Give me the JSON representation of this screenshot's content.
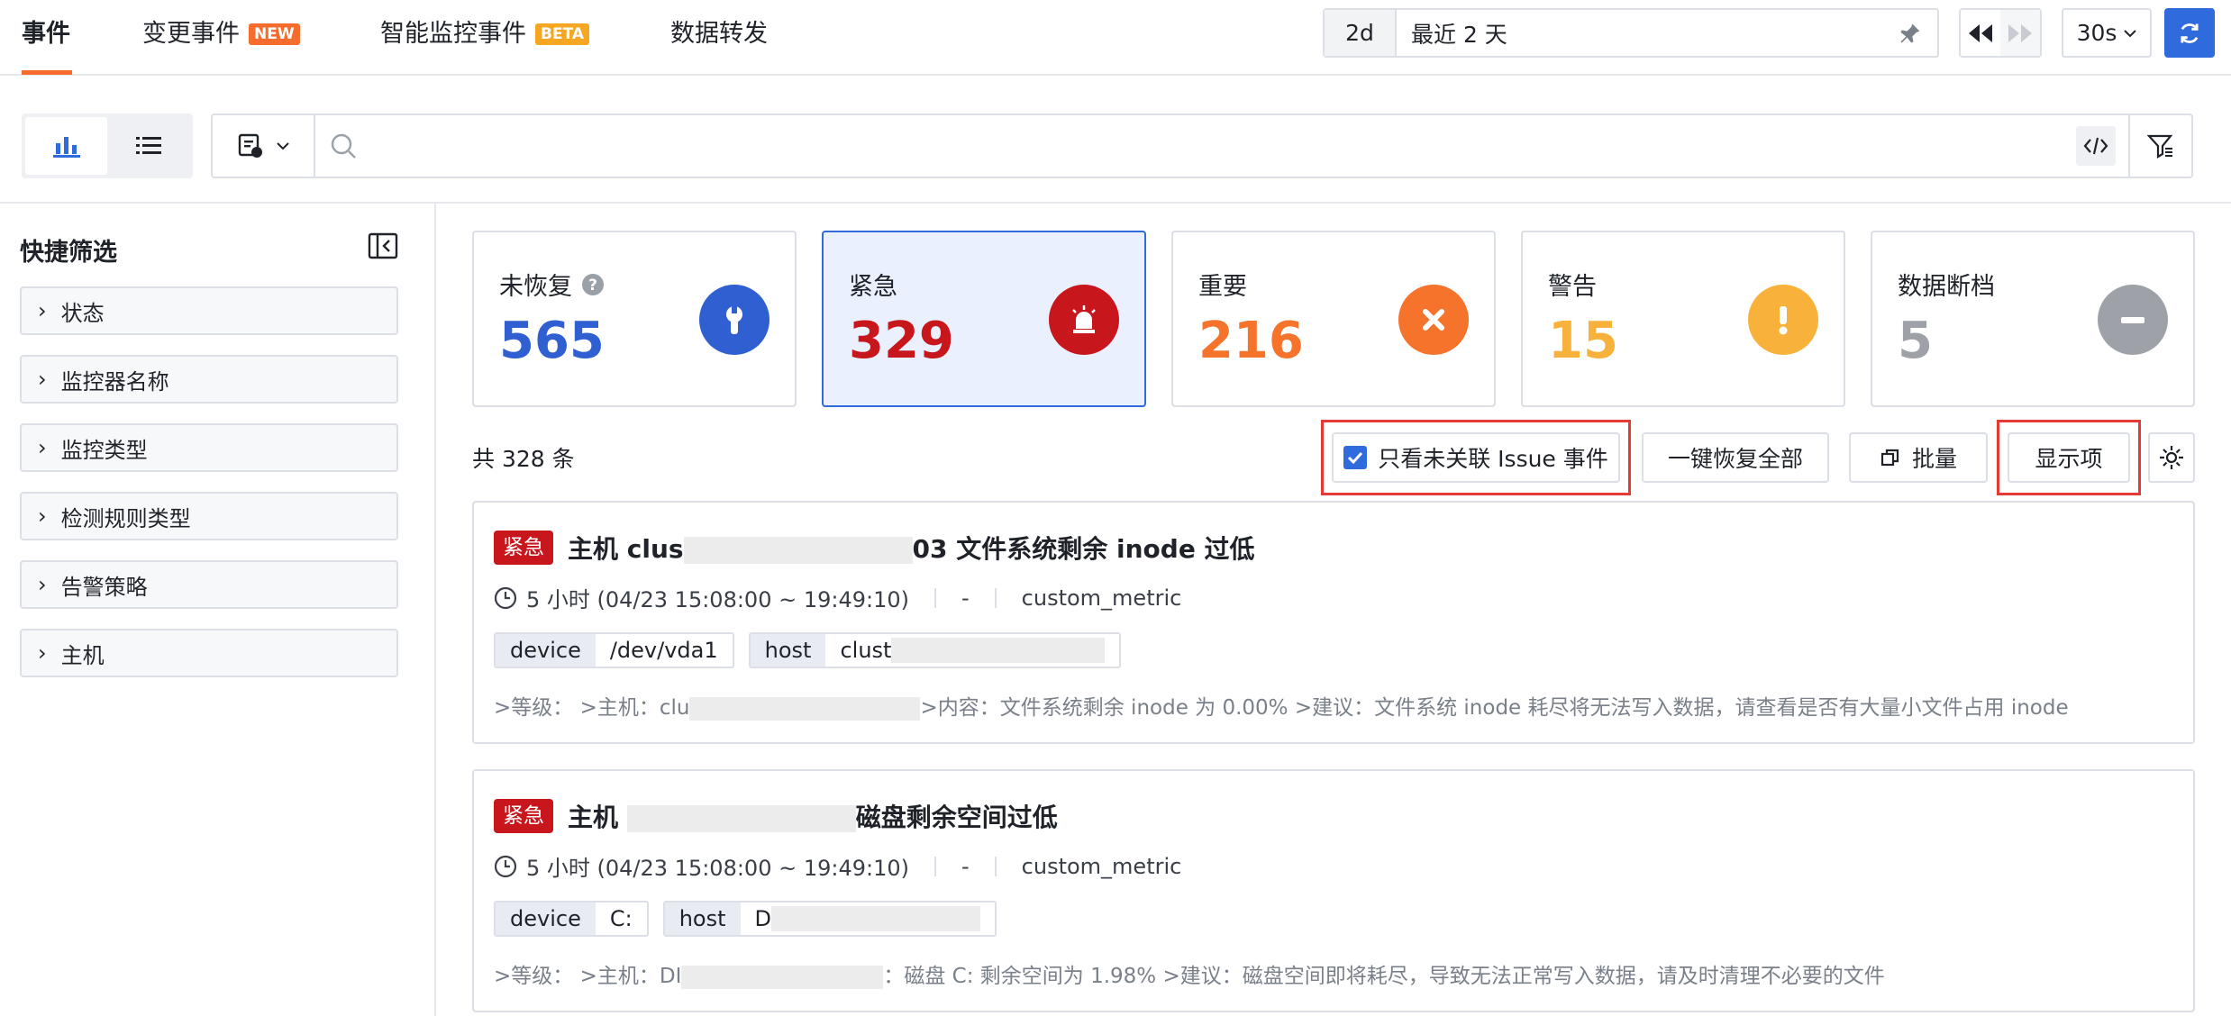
{
  "tabs": [
    {
      "label": "事件",
      "active": true
    },
    {
      "label": "变更事件",
      "badge": "NEW"
    },
    {
      "label": "智能监控事件",
      "badge": "BETA"
    },
    {
      "label": "数据转发"
    }
  ],
  "time": {
    "short": "2d",
    "long": "最近 2 天",
    "interval": "30s"
  },
  "search": {
    "placeholder": ""
  },
  "sidebar": {
    "title": "快捷筛选",
    "items": [
      "状态",
      "监控器名称",
      "监控类型",
      "检测规则类型",
      "告警策略",
      "主机"
    ]
  },
  "stats": [
    {
      "label": "未恢复",
      "value": "565",
      "color": "#2f5fd0",
      "icon": "wrench-icon"
    },
    {
      "label": "紧急",
      "value": "329",
      "color": "#c8161d",
      "icon": "siren-icon"
    },
    {
      "label": "重要",
      "value": "216",
      "color": "#f5732b",
      "icon": "close-icon"
    },
    {
      "label": "警告",
      "value": "15",
      "color": "#f8b23c",
      "icon": "exclaim-icon"
    },
    {
      "label": "数据断档",
      "value": "5",
      "color": "#9ea2a8",
      "icon": "minus-icon"
    }
  ],
  "toolbar": {
    "total": "共 328 条",
    "only_unlinked": "只看未关联 Issue 事件",
    "recover_all": "一键恢复全部",
    "batch": "批量",
    "display": "显示项"
  },
  "events": [
    {
      "level": "紧急",
      "title_a": "主机 clus",
      "title_b": "03 文件系统剩余 inode 过低",
      "duration": "5 小时 (04/23 15:08:00 ~ 19:49:10)",
      "dash": "-",
      "source": "custom_metric",
      "tags": [
        {
          "k": "device",
          "v": "/dev/vda1"
        },
        {
          "k": "host",
          "v": "clust"
        }
      ],
      "content_a": ">等级： >主机：clu",
      "content_b": ">内容：文件系统剩余 inode 为 0.00% >建议：文件系统 inode 耗尽将无法写入数据，请查看是否有大量小文件占用 inode"
    },
    {
      "level": "紧急",
      "title_a": "主机",
      "title_b": "磁盘剩余空间过低",
      "duration": "5 小时 (04/23 15:08:00 ~ 19:49:10)",
      "dash": "-",
      "source": "custom_metric",
      "tags": [
        {
          "k": "device",
          "v": "C:"
        },
        {
          "k": "host",
          "v": "D"
        }
      ],
      "content_a": ">等级： >主机：DI",
      "content_b": "：磁盘 C: 剩余空间为 1.98% >建议：磁盘空间即将耗尽，导致无法正常写入数据，请及时清理不必要的文件"
    }
  ]
}
